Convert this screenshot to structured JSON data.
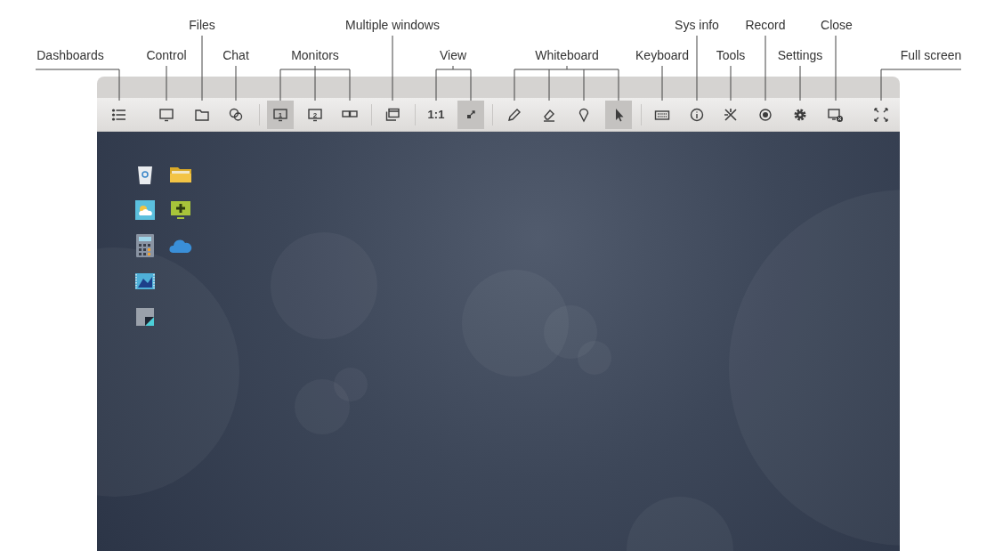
{
  "toolbar": [
    {
      "kind": "button",
      "selected": false
    },
    {
      "kind": "button",
      "selected": false
    },
    {
      "kind": "button",
      "selected": false
    },
    {
      "kind": "button",
      "selected": false
    },
    {
      "kind": "separator"
    },
    {
      "kind": "button",
      "number": "1",
      "selected": true
    },
    {
      "kind": "button",
      "number": "2",
      "selected": false
    },
    {
      "kind": "button",
      "selected": false
    },
    {
      "kind": "separator"
    },
    {
      "kind": "button",
      "selected": false
    },
    {
      "kind": "separator"
    },
    {
      "kind": "text",
      "text": "1:1",
      "selected": false
    },
    {
      "kind": "button",
      "selected": true
    },
    {
      "kind": "separator"
    },
    {
      "kind": "button",
      "selected": false
    },
    {
      "kind": "button",
      "selected": false
    },
    {
      "kind": "button",
      "selected": false
    },
    {
      "kind": "button",
      "selected": true
    },
    {
      "kind": "separator"
    },
    {
      "kind": "button",
      "selected": false
    },
    {
      "kind": "button",
      "selected": false
    },
    {
      "kind": "button",
      "selected": false
    },
    {
      "kind": "button",
      "selected": false
    },
    {
      "kind": "button",
      "selected": false
    },
    {
      "kind": "button",
      "selected": false
    },
    {
      "kind": "button",
      "selected": false
    }
  ],
  "callouts": [
    {
      "text": "Dashboards"
    },
    {
      "text": "Control"
    },
    {
      "text": "Files"
    },
    {
      "text": "Chat"
    },
    {
      "text": "Monitors"
    },
    {
      "text": "Multiple windows"
    },
    {
      "text": "View"
    },
    {
      "text": "Whiteboard"
    },
    {
      "text": "Keyboard"
    },
    {
      "text": "Sys info"
    },
    {
      "text": "Tools"
    },
    {
      "text": "Record"
    },
    {
      "text": "Settings"
    },
    {
      "text": "Close"
    },
    {
      "text": "Full screen"
    }
  ]
}
